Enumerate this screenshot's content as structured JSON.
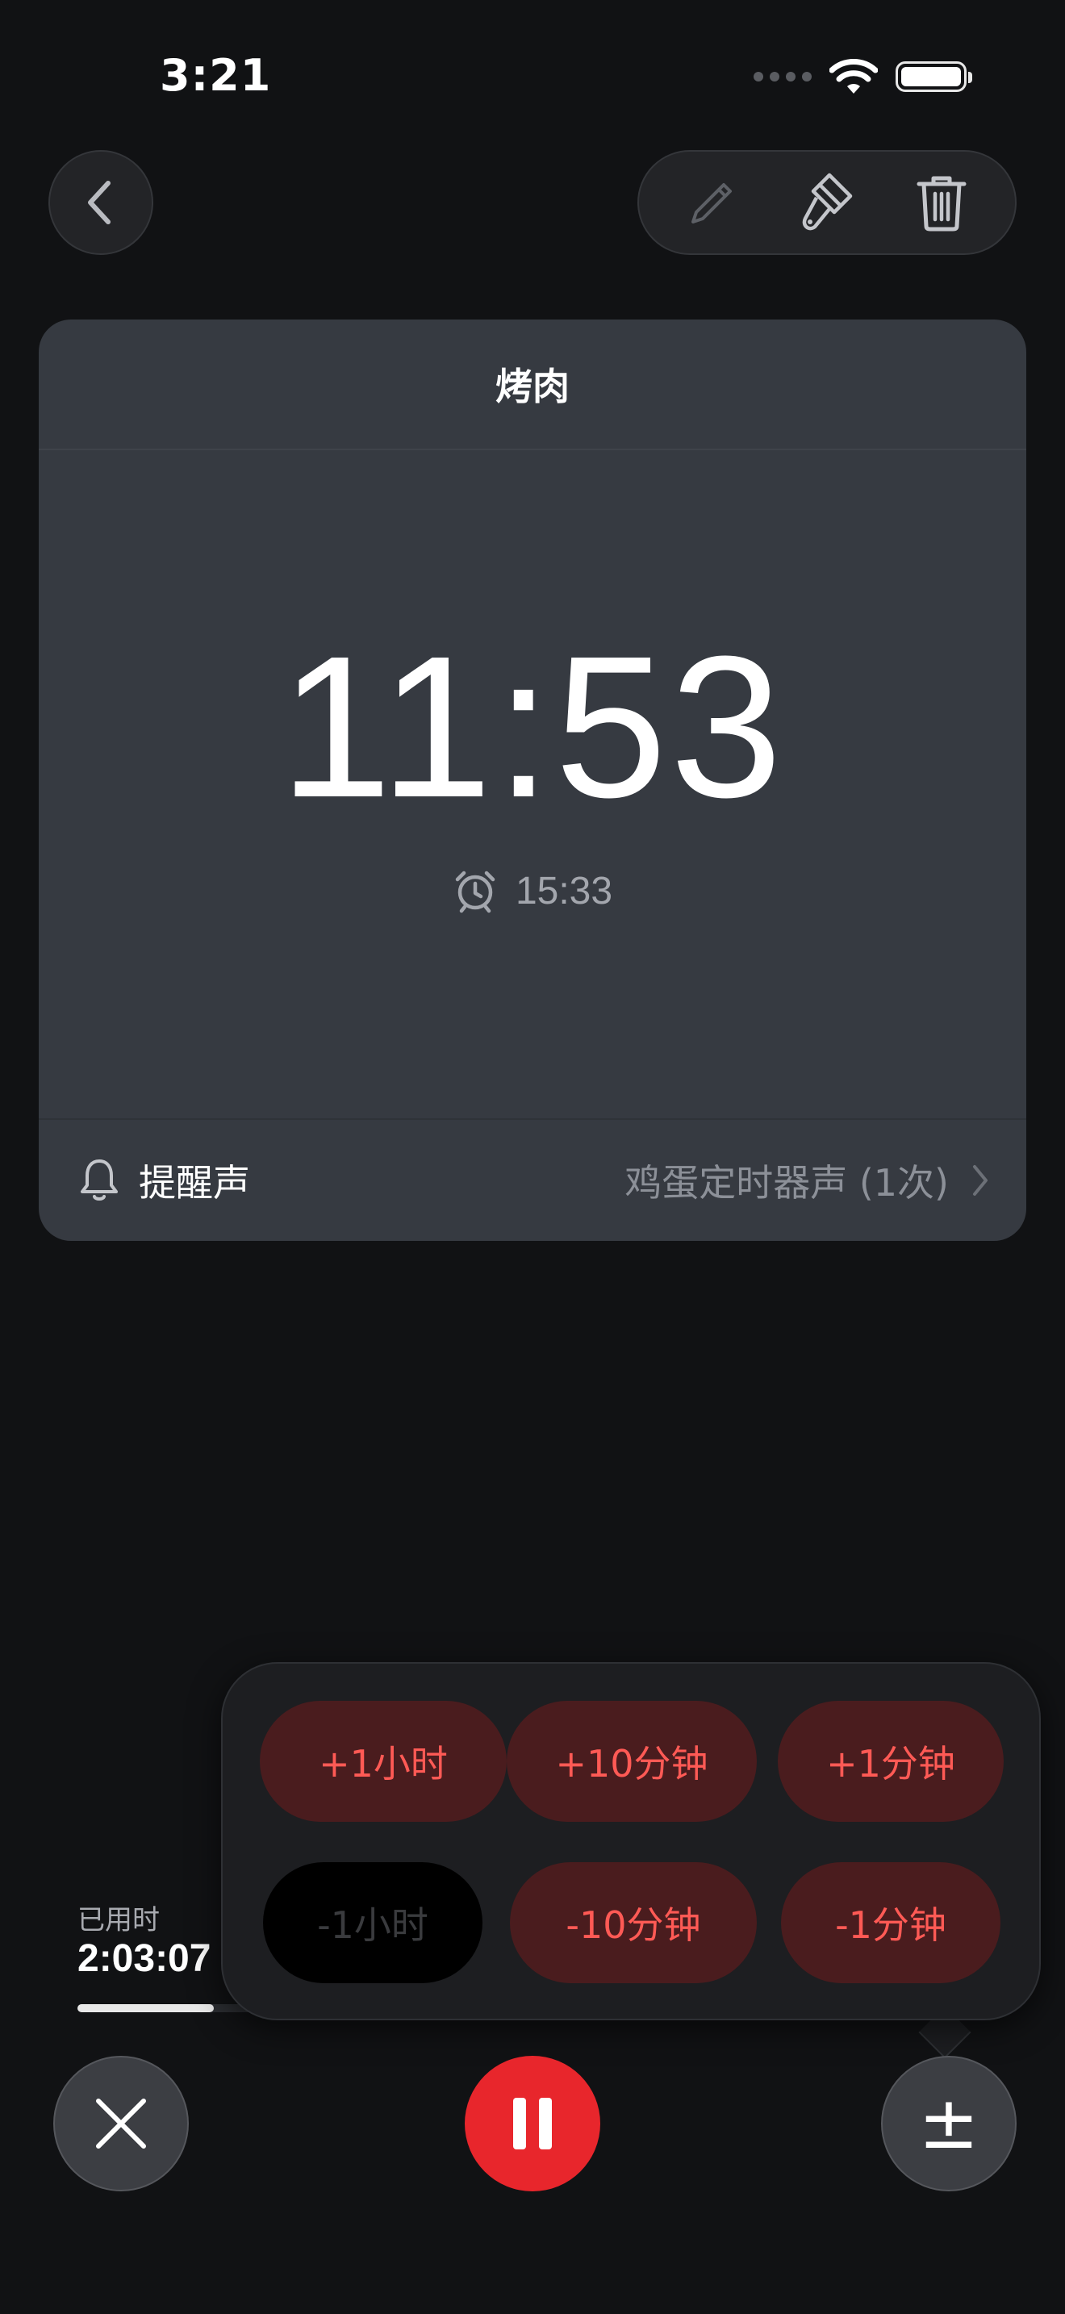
{
  "status_bar": {
    "time": "3:21",
    "icons": [
      "signal-dots-icon",
      "wifi-icon",
      "battery-icon"
    ]
  },
  "toolbar": {
    "back_icon": "chevron-left-icon",
    "tools": [
      "pencil-icon",
      "paintbrush-icon",
      "trash-icon"
    ]
  },
  "timer": {
    "title": "烤肉",
    "remaining": "11:53",
    "end_time": "15:33",
    "sound": {
      "label": "提醒声",
      "value": "鸡蛋定时器声 (1次)"
    }
  },
  "elapsed": {
    "label": "已用时",
    "value": "2:03:07",
    "progress": 0.15
  },
  "adjust_menu": {
    "increase": [
      "+1小时",
      "+10分钟",
      "+1分钟"
    ],
    "decrease": [
      "-1小时",
      "-10分钟",
      "-1分钟"
    ],
    "decrease_disabled": [
      true,
      false,
      false
    ]
  },
  "controls": {
    "cancel_icon": "close-icon",
    "pause_icon": "pause-icon",
    "adjust_glyph": "±"
  },
  "colors": {
    "accent_red": "#e8262c",
    "adjust_text": "#ff5a55",
    "card_bg": "#363a41"
  }
}
